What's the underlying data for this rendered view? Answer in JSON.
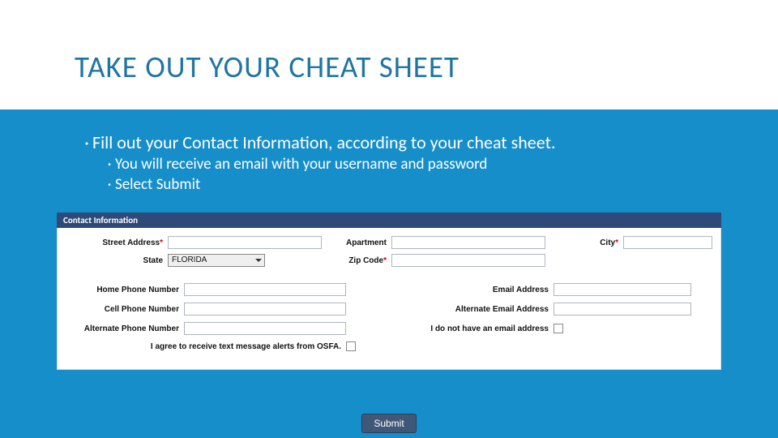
{
  "title": "TAKE OUT YOUR CHEAT SHEET",
  "bullets": {
    "main": "Fill out your Contact Information, according to your cheat sheet.",
    "sub1": "You will receive an email with your username and password",
    "sub2": "Select Submit"
  },
  "form": {
    "panel_title": "Contact Information",
    "labels": {
      "street": "Street Address",
      "apartment": "Apartment",
      "city": "City",
      "state": "State",
      "zip": "Zip Code",
      "home_phone": "Home Phone Number",
      "cell_phone": "Cell Phone Number",
      "alt_phone": "Alternate Phone Number",
      "email": "Email Address",
      "alt_email": "Alternate Email Address",
      "no_email": "I do not have an email address",
      "text_alerts": "I agree to receive text message alerts from OSFA."
    },
    "state_value": "FLORIDA",
    "submit": "Submit",
    "req_mark": "*"
  }
}
